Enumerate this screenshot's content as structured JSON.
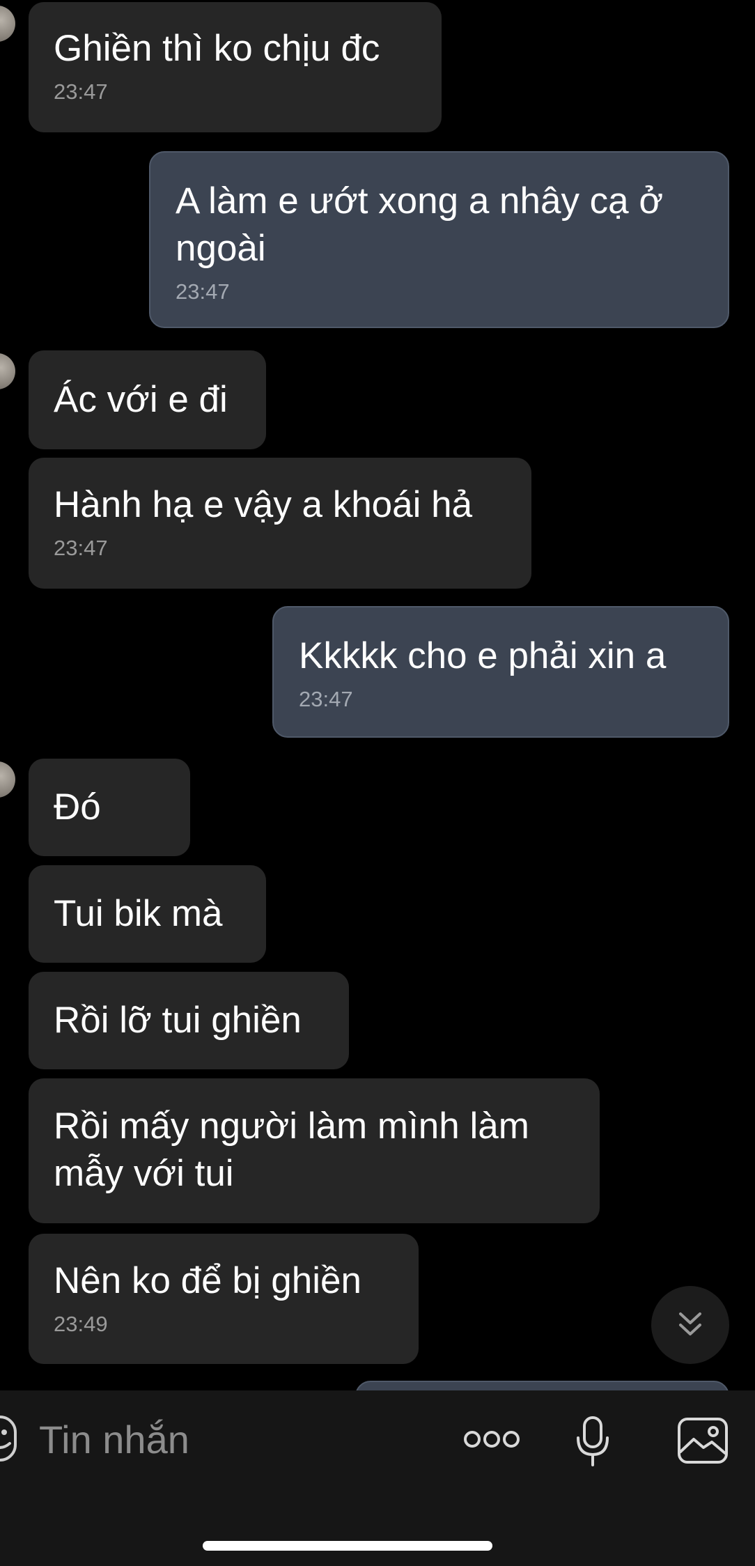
{
  "messages": [
    {
      "direction": "in",
      "text": [
        "Ghiền thì ko chịu đc"
      ],
      "time": "23:47"
    },
    {
      "direction": "out",
      "text": [
        "A làm e ướt xong a nhây cạ ở",
        "ngoài"
      ],
      "time": "23:47"
    },
    {
      "direction": "in",
      "text": [
        "Ác với e đi"
      ]
    },
    {
      "direction": "in",
      "text": [
        "Hành hạ e vậy a khoái hả"
      ],
      "time": "23:47"
    },
    {
      "direction": "out",
      "text": [
        "Kkkkk cho e phải xin a"
      ],
      "time": "23:47"
    },
    {
      "direction": "in",
      "text": [
        "Đó"
      ]
    },
    {
      "direction": "in",
      "text": [
        "Tui bik mà"
      ]
    },
    {
      "direction": "in",
      "text": [
        "Rồi lỡ tui ghiền"
      ]
    },
    {
      "direction": "in",
      "text": [
        "Rồi mấy người làm mình làm",
        "mẫy với tui"
      ]
    },
    {
      "direction": "in",
      "text": [
        "Nên ko để bị ghiền"
      ],
      "time": "23:49"
    }
  ],
  "composer": {
    "placeholder": "Tin nhắn"
  },
  "icons": {
    "emoji": "emoji-icon",
    "more": "more-options-icon",
    "mic": "microphone-icon",
    "gallery": "image-gallery-icon",
    "scroll_down": "double-chevron-down-icon"
  },
  "colors": {
    "background": "#000000",
    "incoming_bubble": "#262626",
    "outgoing_bubble": "#3c4452",
    "timestamp": "#9a9a9a",
    "composer_bg": "#161616"
  }
}
